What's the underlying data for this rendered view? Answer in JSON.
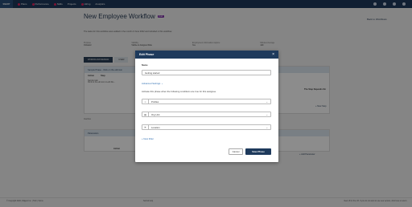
{
  "nav": {
    "logo_text": "SMART",
    "items": [
      {
        "label": "Plans"
      },
      {
        "label": "Performance"
      },
      {
        "label": "Skills"
      },
      {
        "label": "Projects"
      },
      {
        "label": "Hiring"
      },
      {
        "label": "Analytics"
      }
    ]
  },
  "page": {
    "title": "New Employee Workflow",
    "draft_badge": "Draft",
    "back_link": "Back to Workflows",
    "description": "The tasks for this workflow were added in the month of June 2022 and included in this workflow.",
    "summary": [
      {
        "label": "Purpose",
        "value": "Onboard"
      },
      {
        "label": "Visibility",
        "value": "Visible to Assigned Role"
      },
      {
        "label": "Employment information capture",
        "value": "Yes"
      },
      {
        "label": "Minutes Average",
        "value": "140"
      }
    ],
    "tabs": [
      "WORKFLOW DESIGN",
      "USER"
    ],
    "phase_bar": "Sample Phase - Click on the edit icon",
    "table_headers": [
      "Action",
      "Step"
    ],
    "steps_depend": "The Step Depends On",
    "step_row_title": "Sample task",
    "step_row_sub": "Click on the edit icon to edit this...",
    "add_step": "+ New Step",
    "inactive": "Inactive",
    "parameters_bar": "Parameters",
    "action_col": "Action",
    "add_parameter": "+ Add Parameter"
  },
  "footer": {
    "left": "© Copyright 2022, Diligent Inc. | T&C | Terms",
    "mid": "Submit help",
    "right": "New UI for the UX. If you do not want to use new version, click here to return."
  },
  "modal": {
    "title": "Edit Phase",
    "name_label": "Name",
    "name_value": "Getting started",
    "advanced_settings": "Advanced Settings",
    "conditions_text": "Activate this phase when the following conditions are true for this assignee.",
    "conditions": [
      {
        "icon": "user-icon",
        "glyph": "☺",
        "value": "Profiles"
      },
      {
        "icon": "org-icon",
        "glyph": "▦",
        "value": "Org Unit"
      },
      {
        "icon": "location-icon",
        "glyph": "⚑",
        "value": "Location"
      }
    ],
    "new_filter": "+ New Filter",
    "cancel_label": "Cancel",
    "save_label": "Save Phase"
  },
  "colors": {
    "nav_bg": "#1e3a5c",
    "badge": "#7e2fa8",
    "link": "#2b6cb0",
    "primary_button": "#1e3a5c"
  }
}
